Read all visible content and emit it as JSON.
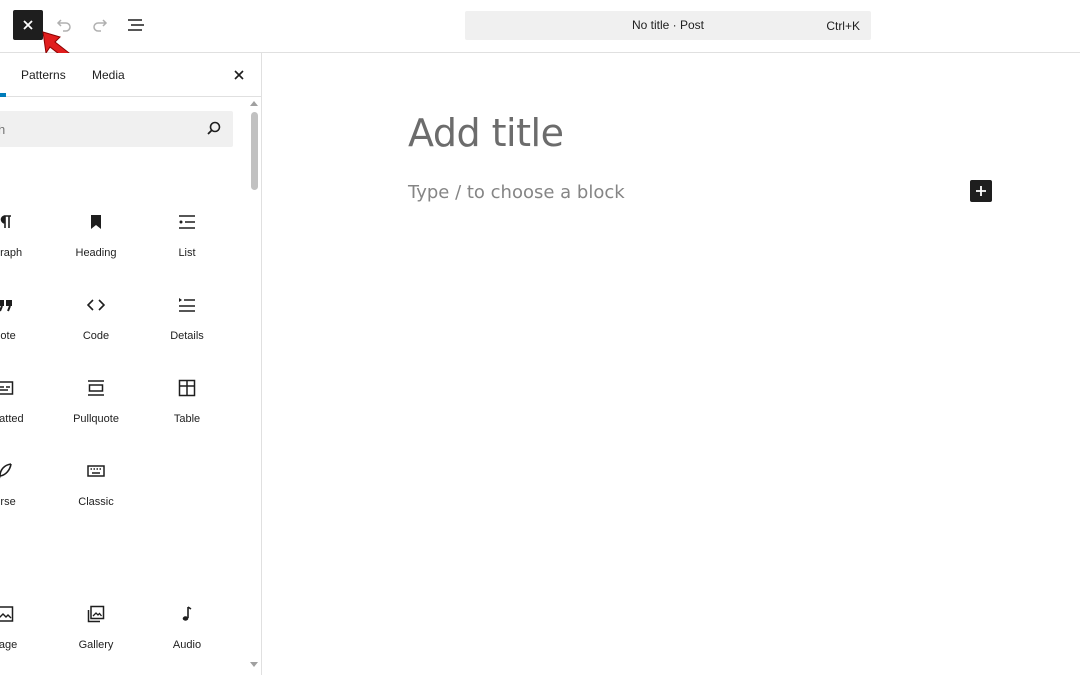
{
  "topbar": {
    "close_icon": "close-icon",
    "undo_icon": "undo-icon",
    "redo_icon": "redo-icon",
    "list_view_icon": "list-view-icon",
    "command": {
      "title": "No title · Post",
      "shortcut": "Ctrl+K"
    }
  },
  "sidebar": {
    "tabs": [
      {
        "label": "Patterns"
      },
      {
        "label": "Media"
      }
    ],
    "active_tab_color": "#007cba",
    "search_placeholder": "Search",
    "search_visible_text": "h",
    "blocks": [
      {
        "label": "Paragraph",
        "visible": "agraph",
        "icon": "paragraph-icon"
      },
      {
        "label": "Heading",
        "visible": "Heading",
        "icon": "heading-icon"
      },
      {
        "label": "List",
        "visible": "List",
        "icon": "list-icon"
      },
      {
        "label": "Quote",
        "visible": "uote",
        "icon": "quote-icon"
      },
      {
        "label": "Code",
        "visible": "Code",
        "icon": "code-icon"
      },
      {
        "label": "Details",
        "visible": "Details",
        "icon": "details-icon"
      },
      {
        "label": "Preformatted",
        "visible": "rmatted",
        "icon": "preformatted-icon"
      },
      {
        "label": "Pullquote",
        "visible": "Pullquote",
        "icon": "pullquote-icon"
      },
      {
        "label": "Table",
        "visible": "Table",
        "icon": "table-icon"
      },
      {
        "label": "Verse",
        "visible": "erse",
        "icon": "verse-icon"
      },
      {
        "label": "Classic",
        "visible": "Classic",
        "icon": "classic-icon"
      },
      {
        "label": "Image",
        "visible": "nage",
        "icon": "image-icon"
      },
      {
        "label": "Gallery",
        "visible": "Gallery",
        "icon": "gallery-icon"
      },
      {
        "label": "Audio",
        "visible": "Audio",
        "icon": "audio-icon"
      }
    ]
  },
  "editor": {
    "title_placeholder": "Add title",
    "block_placeholder": "Type / to choose a block"
  },
  "colors": {
    "accent": "#007cba",
    "dark": "#1e1e1e",
    "annotation_arrow": "#e11d1d"
  }
}
